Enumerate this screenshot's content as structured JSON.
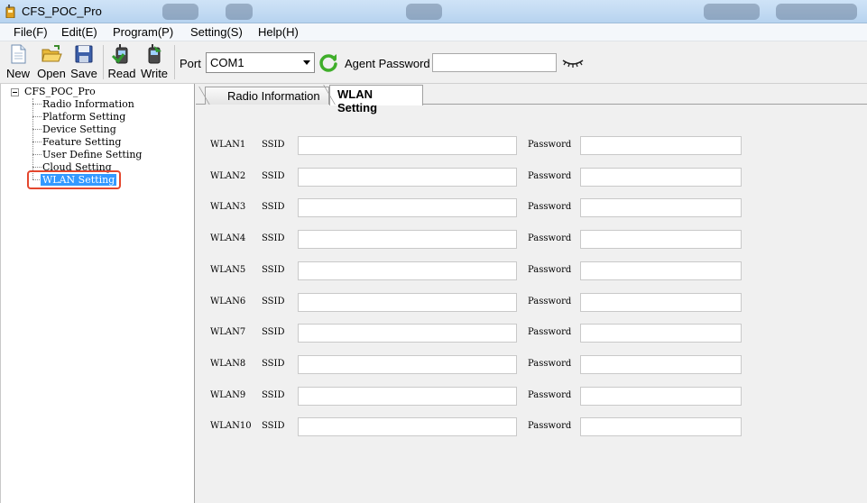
{
  "window": {
    "title": "CFS_POC_Pro"
  },
  "menu": [
    "File(F)",
    "Edit(E)",
    "Program(P)",
    "Setting(S)",
    "Help(H)"
  ],
  "toolbar": {
    "new_label": "New",
    "open_label": "Open",
    "save_label": "Save",
    "read_label": "Read",
    "write_label": "Write",
    "port_label": "Port",
    "port_value": "COM1",
    "agent_password_label": "Agent Password",
    "agent_password_value": ""
  },
  "tree": {
    "root": "CFS_POC_Pro",
    "items": [
      "Radio Information",
      "Platform Setting",
      "Device Setting",
      "Feature Setting",
      "User Define Setting",
      "Cloud Setting",
      "WLAN Setting"
    ],
    "selected_index": 6
  },
  "tabs": [
    {
      "label": "Radio Information",
      "active": false
    },
    {
      "label": "WLAN Setting",
      "active": true
    }
  ],
  "wlan": {
    "ssid_label": "SSID",
    "password_label": "Password",
    "rows": [
      {
        "name": "WLAN1",
        "ssid": "",
        "password": ""
      },
      {
        "name": "WLAN2",
        "ssid": "",
        "password": ""
      },
      {
        "name": "WLAN3",
        "ssid": "",
        "password": ""
      },
      {
        "name": "WLAN4",
        "ssid": "",
        "password": ""
      },
      {
        "name": "WLAN5",
        "ssid": "",
        "password": ""
      },
      {
        "name": "WLAN6",
        "ssid": "",
        "password": ""
      },
      {
        "name": "WLAN7",
        "ssid": "",
        "password": ""
      },
      {
        "name": "WLAN8",
        "ssid": "",
        "password": ""
      },
      {
        "name": "WLAN9",
        "ssid": "",
        "password": ""
      },
      {
        "name": "WLAN10",
        "ssid": "",
        "password": ""
      }
    ]
  },
  "colors": {
    "selection": "#3399ff",
    "highlight": "#e4472e",
    "refresh": "#3fae2a"
  }
}
